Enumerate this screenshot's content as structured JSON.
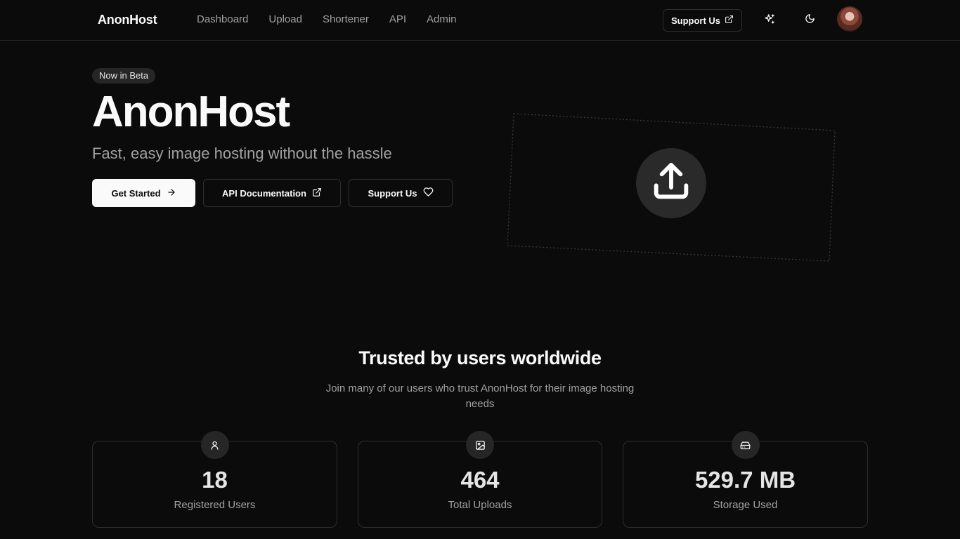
{
  "nav": {
    "brand": "AnonHost",
    "links": [
      "Dashboard",
      "Upload",
      "Shortener",
      "API",
      "Admin"
    ],
    "support_label": "Support Us",
    "icons": [
      "external-link-icon",
      "sparkles-icon",
      "moon-icon"
    ]
  },
  "hero": {
    "badge": "Now in Beta",
    "title": "AnonHost",
    "subtitle": "Fast, easy image hosting without the hassle",
    "get_started": "Get Started",
    "api_docs": "API Documentation",
    "support": "Support Us"
  },
  "stats": {
    "title": "Trusted by users worldwide",
    "description": "Join many of our users who trust AnonHost for their image hosting needs",
    "items": [
      {
        "value": "18",
        "label": "Registered Users",
        "icon": "user-icon"
      },
      {
        "value": "464",
        "label": "Total Uploads",
        "icon": "image-icon"
      },
      {
        "value": "529.7 MB",
        "label": "Storage Used",
        "icon": "hard-drive-icon"
      }
    ]
  },
  "colors": {
    "background": "#0b0b0b",
    "border": "#2e2e2e",
    "muted_text": "#a1a1a1",
    "primary_button": "#fafafa"
  }
}
